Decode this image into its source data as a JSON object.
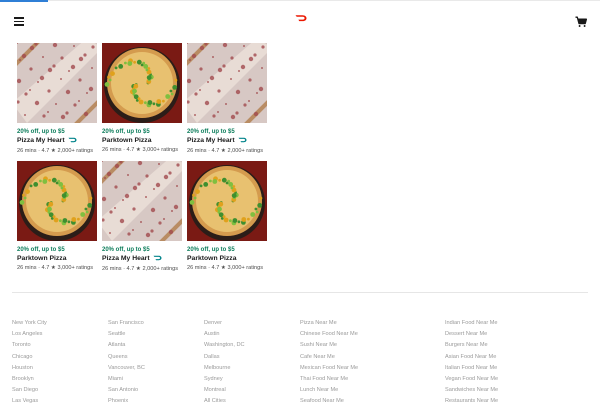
{
  "header": {
    "menu_icon": "hamburger-menu-icon",
    "logo_icon": "doordash-logo-icon",
    "cart_icon": "shopping-cart-icon",
    "brand_color": "#eb1700"
  },
  "loading_progress": 0.08,
  "stores": [
    {
      "promo": "20% off, up to $5",
      "name": "Pizza My Heart",
      "dashpass": true,
      "meta": "26 mins · 4.7 ★ 2,000+ ratings",
      "image": "white-pizza"
    },
    {
      "promo": "20% off, up to $5",
      "name": "Parktown Pizza",
      "dashpass": false,
      "meta": "26 mins · 4.7 ★ 3,000+ ratings",
      "image": "veggie-pizza"
    },
    {
      "promo": "20% off, up to $5",
      "name": "Pizza My Heart",
      "dashpass": true,
      "meta": "26 mins · 4.7 ★ 2,000+ ratings",
      "image": "white-pizza"
    },
    {
      "promo": "20% off, up to $5",
      "name": "Parktown Pizza",
      "dashpass": false,
      "meta": "26 mins · 4.7 ★ 3,000+ ratings",
      "image": "veggie-pizza"
    },
    {
      "promo": "20% off, up to $5",
      "name": "Pizza My Heart",
      "dashpass": true,
      "meta": "26 mins · 4.7 ★ 2,000+ ratings",
      "image": "white-pizza"
    },
    {
      "promo": "20% off, up to $5",
      "name": "Parktown Pizza",
      "dashpass": false,
      "meta": "26 mins · 4.7 ★ 3,000+ ratings",
      "image": "veggie-pizza"
    }
  ],
  "footer": {
    "cities_1": [
      "New York City",
      "Los Angeles",
      "Toronto",
      "Chicago",
      "Houston",
      "Brooklyn",
      "San Diego",
      "Las Vegas"
    ],
    "cities_2": [
      "San Francisco",
      "Seattle",
      "Atlanta",
      "Queens",
      "Vancouver, BC",
      "Miami",
      "San Antonio",
      "Phoenix"
    ],
    "cities_3": [
      "Denver",
      "Austin",
      "Washington, DC",
      "Dallas",
      "Melbourne",
      "Sydney",
      "Montreal",
      "All Cities"
    ],
    "near_me_1": [
      "Pizza Near Me",
      "Chinese Food Near Me",
      "Sushi Near Me",
      "Cafe Near Me",
      "Mexican Food Near Me",
      "Thai Food Near Me",
      "Lunch Near Me",
      "Seafood Near Me"
    ],
    "near_me_2": [
      "Indian Food Near Me",
      "Dessert Near Me",
      "Burgers Near Me",
      "Asian Food Near Me",
      "Italian Food Near Me",
      "Vegan Food Near Me",
      "Sandwiches Near Me",
      "Restaurants Near Me"
    ]
  }
}
